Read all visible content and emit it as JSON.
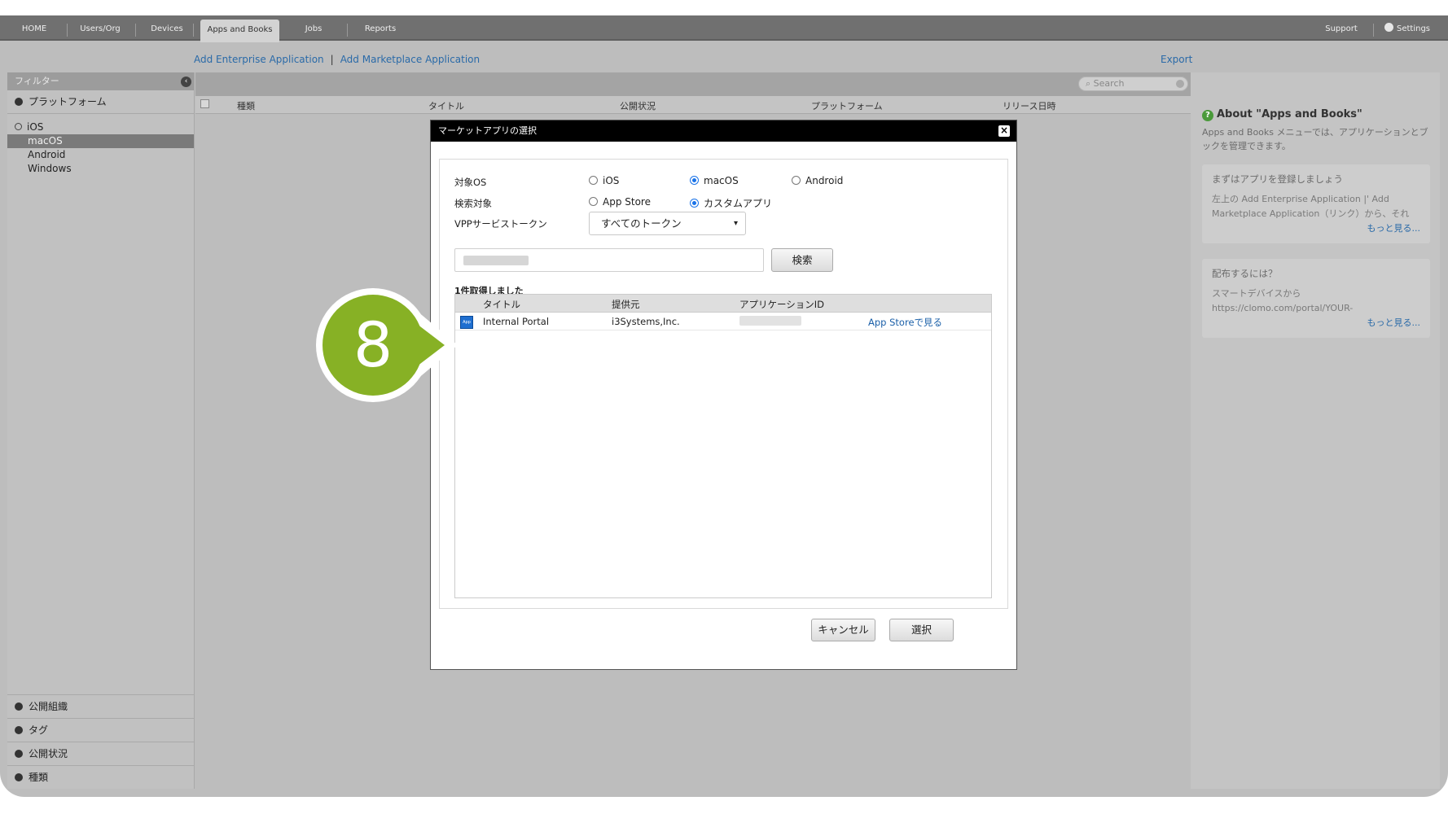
{
  "nav": {
    "tabs": [
      "HOME",
      "Users/Org",
      "Devices",
      "Apps and Books",
      "Jobs",
      "Reports"
    ],
    "active_tab": "Apps and Books",
    "support": "Support",
    "settings": "Settings"
  },
  "sublinks": {
    "add_enterprise": "Add Enterprise Application",
    "separator": "|",
    "add_marketplace": "Add Marketplace Application",
    "export": "Export"
  },
  "filter": {
    "header": "フィルター",
    "platform_section": "プラットフォーム",
    "platforms": [
      "iOS",
      "macOS",
      "Android",
      "Windows"
    ],
    "selected_platform": "macOS",
    "bottom_sections": [
      "公開組織",
      "タグ",
      "公開状況",
      "種類"
    ]
  },
  "list": {
    "search_placeholder": "Search",
    "columns": [
      "種類",
      "タイトル",
      "公開状況",
      "プラットフォーム",
      "リリース日時"
    ]
  },
  "help": {
    "title": "About \"Apps and Books\"",
    "description": "Apps and Books メニューでは、アプリケーションとブックを管理できます。",
    "cards": [
      {
        "title": "まずはアプリを登録しましょう",
        "body": "左上の Add Enterprise Application |' Add Marketplace Application（リンク）から、それ",
        "more": "もっと見る..."
      },
      {
        "title": "配布するには？",
        "body": "スマートデバイスから https://clomo.com/portal/YOUR-",
        "more": "もっと見る..."
      }
    ]
  },
  "modal": {
    "title": "マーケットアプリの選択",
    "os_label": "対象OS",
    "os_options": [
      "iOS",
      "macOS",
      "Android"
    ],
    "os_selected": "macOS",
    "target_label": "検索対象",
    "target_options": [
      "App Store",
      "カスタムアプリ"
    ],
    "target_selected": "カスタムアプリ",
    "vpp_label": "VPPサービストークン",
    "vpp_value": "すべてのトークン",
    "search_button": "検索",
    "result_count": "1件取得しました",
    "table_columns": [
      "タイトル",
      "提供元",
      "アプリケーションID"
    ],
    "rows": [
      {
        "title": "Internal Portal",
        "provider": "i3Systems,Inc.",
        "link": "App Storeで見る"
      }
    ],
    "cancel_button": "キャンセル",
    "select_button": "選択"
  },
  "step_badge": "8"
}
